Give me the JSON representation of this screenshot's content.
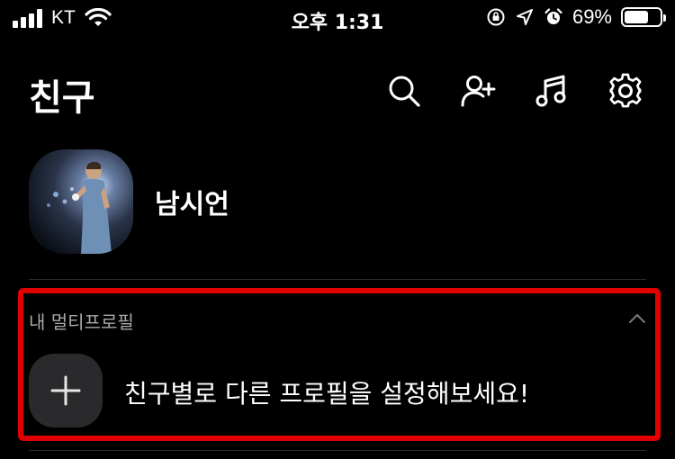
{
  "status_bar": {
    "carrier": "KT",
    "time": "오후 1:31",
    "battery_percent": "69%",
    "battery_level": 0.69,
    "icons": [
      "signal-icon",
      "wifi-icon",
      "orientation-lock-icon",
      "location-icon",
      "alarm-icon",
      "battery-icon"
    ]
  },
  "header": {
    "title": "친구",
    "actions": [
      "search-icon",
      "add-friend-icon",
      "music-icon",
      "settings-icon"
    ]
  },
  "profile": {
    "name": "남시언"
  },
  "multi_profile": {
    "section_label": "내 멀티프로필",
    "cta_text": "친구별로 다른 프로필을 설정해보세요!",
    "add_icon": "plus-icon",
    "collapse_icon": "chevron-up-icon"
  },
  "colors": {
    "background": "#000000",
    "highlight": "#e00000",
    "tile": "#2a2a2c",
    "muted_text": "#a9a9a9"
  }
}
